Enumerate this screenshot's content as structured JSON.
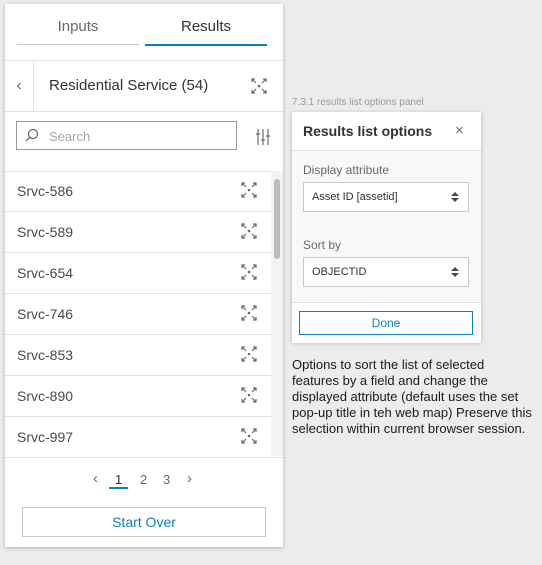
{
  "tabs": {
    "inputs": "Inputs",
    "results": "Results"
  },
  "header": {
    "back_icon": "chevron-left-icon",
    "title": "Residential Service (54)",
    "zoom_icon": "zoom-to-icon"
  },
  "search": {
    "placeholder": "Search",
    "icon": "search-icon",
    "filter_icon": "list-options-icon"
  },
  "items": [
    {
      "label": "Srvc-586"
    },
    {
      "label": "Srvc-589"
    },
    {
      "label": "Srvc-654"
    },
    {
      "label": "Srvc-746"
    },
    {
      "label": "Srvc-853"
    },
    {
      "label": "Srvc-890"
    },
    {
      "label": "Srvc-997"
    }
  ],
  "pagination": {
    "prev": "‹",
    "pages": [
      "1",
      "2",
      "3"
    ],
    "current": "1",
    "next": "›"
  },
  "start_over": "Start Over",
  "caption": "7.3.1 results list options panel",
  "popover": {
    "title": "Results list options",
    "close": "×",
    "display_label": "Display attribute",
    "display_value": "Asset ID [assetid]",
    "sort_label": "Sort by",
    "sort_value": "OBJECTID",
    "done": "Done"
  },
  "note": "Options to sort the list of selected features by a field and change the displayed attribute (default uses the set pop-up title in teh web map) Preserve this selection within current browser session.",
  "colors": {
    "accent": "#0f7fc1",
    "background": "#ececec",
    "panel": "#ffffff"
  }
}
